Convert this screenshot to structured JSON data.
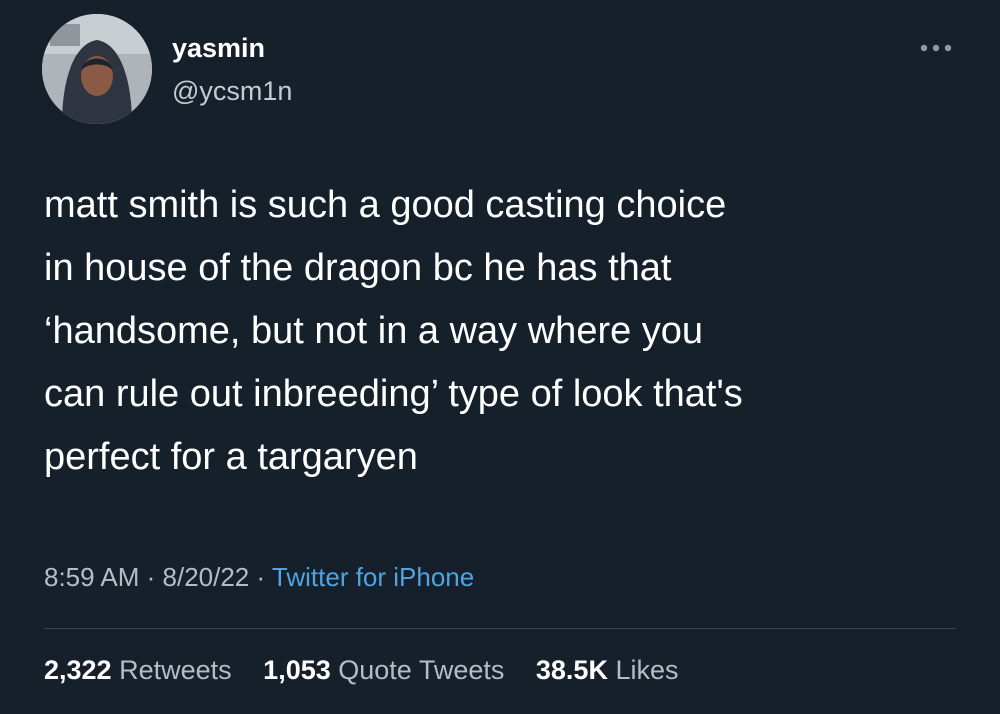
{
  "user": {
    "name": "yasmin",
    "handle": "@ycsm1n"
  },
  "tweet": {
    "text": "matt smith is such a good casting choice\nin house of the dragon bc he has that\n‘handsome, but not in a way where you\ncan rule out inbreeding’ type of look that's\nperfect for a targaryen"
  },
  "meta": {
    "time": "8:59 AM",
    "separator": " · ",
    "date": "8/20/22",
    "source": "Twitter for iPhone"
  },
  "stats": {
    "retweets_count": "2,322",
    "retweets_label": "Retweets",
    "quotes_count": "1,053",
    "quotes_label": "Quote Tweets",
    "likes_count": "38.5K",
    "likes_label": "Likes"
  },
  "icons": {
    "more": "more-horizontal-icon",
    "avatar": "profile-photo"
  },
  "colors": {
    "background": "#15202b",
    "link": "#4ea3e0",
    "muted_text": "#b4bcc4",
    "divider": "#38444d"
  }
}
